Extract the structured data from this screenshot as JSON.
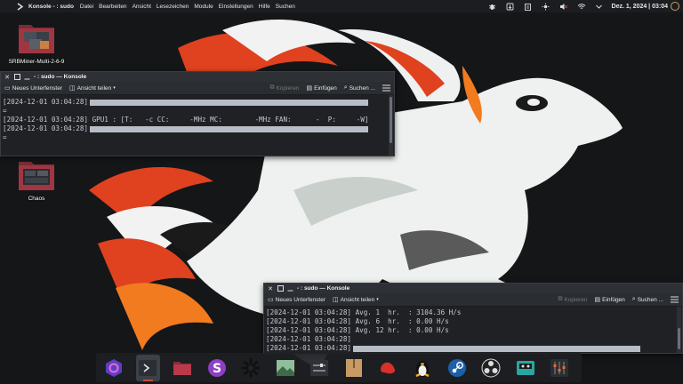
{
  "top_panel": {
    "app_name": "Konsole - : sudo",
    "menu": [
      "Datei",
      "Bearbeiten",
      "Ansicht",
      "Lesezeichen",
      "Module",
      "Einstellungen",
      "Hilfe",
      "Suchen"
    ],
    "clock": "Dez. 1, 2024 | 03:04",
    "tray_icons": [
      "bug-icon",
      "update-icon",
      "clipboard-icon",
      "brightness-icon",
      "volume-icon",
      "network-icon",
      "chevron-down-icon"
    ]
  },
  "desktop": {
    "icons": [
      {
        "label": "SRBMiner-Multi-2-6-9",
        "icon": "folder-icon"
      },
      {
        "label": "Chaos",
        "icon": "folder-icon"
      }
    ]
  },
  "window1": {
    "title": "- : sudo — Konsole",
    "toolbar": {
      "new_tab": "Neues Unterfenster",
      "split_view": "Ansicht teilen",
      "copy": "Kopieren",
      "paste": "Einfügen",
      "find": "Suchen ..."
    },
    "lines": [
      {
        "ts": "[2024-12-01 03:04:28]",
        "text": ""
      },
      {
        "ts": "",
        "text": "="
      },
      {
        "ts": "[2024-12-01 03:04:28]",
        "text": " GPU1 : [T:   -c CC:     -MHz MC:        -MHz FAN:      -  P:     -W]"
      },
      {
        "ts": "[2024-12-01 03:04:28]",
        "text": ""
      },
      {
        "ts": "",
        "text": "="
      }
    ]
  },
  "window2": {
    "title": "- : sudo — Konsole",
    "toolbar": {
      "new_tab": "Neues Unterfenster",
      "split_view": "Ansicht teilen",
      "copy": "Kopieren",
      "paste": "Einfügen",
      "find": "Suchen ..."
    },
    "lines": [
      {
        "ts": "[2024-12-01 03:04:28]",
        "text": " Avg. 1  hr.  : 3104.36 H/s"
      },
      {
        "ts": "[2024-12-01 03:04:28]",
        "text": " Avg. 6  hr.  : 0.00 H/s"
      },
      {
        "ts": "[2024-12-01 03:04:28]",
        "text": " Avg. 12 hr.  : 0.00 H/s"
      },
      {
        "ts": "[2024-12-01 03:04:28]",
        "text": ""
      },
      {
        "ts": "[2024-12-01 03:04:28]",
        "text": ""
      }
    ]
  },
  "dock": {
    "items": [
      {
        "name": "app-launcher-icon",
        "active": false
      },
      {
        "name": "konsole-icon",
        "active": true
      },
      {
        "name": "files-icon",
        "active": false
      },
      {
        "name": "s-app-icon",
        "active": false
      },
      {
        "name": "asterisk-app-icon",
        "active": false
      },
      {
        "name": "image-viewer-icon",
        "active": false
      },
      {
        "name": "system-monitor-icon",
        "active": false
      },
      {
        "name": "archive-icon",
        "active": false
      },
      {
        "name": "red-hat-icon",
        "active": false
      },
      {
        "name": "tux-icon",
        "active": false
      },
      {
        "name": "steam-icon",
        "active": false
      },
      {
        "name": "obs-icon",
        "active": false
      },
      {
        "name": "terminal-cassette-icon",
        "active": false
      },
      {
        "name": "mixer-icon",
        "active": false
      }
    ]
  },
  "colors": {
    "accent": "#c84a3a",
    "panel_bg": "#1b1d20",
    "terminal_bg": "#1f2125",
    "terminal_text": "#c7cbd1"
  }
}
